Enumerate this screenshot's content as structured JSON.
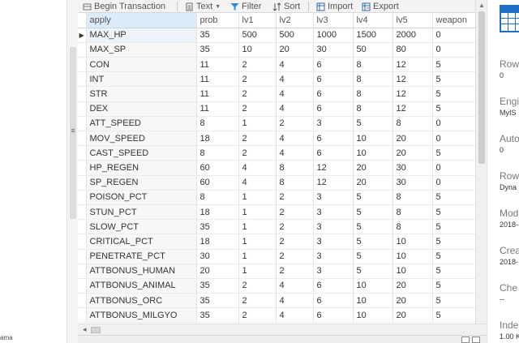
{
  "left_panel": {
    "tail_text": "ama"
  },
  "toolbar": {
    "begin_transaction": "Begin Transaction",
    "text": "Text",
    "filter": "Filter",
    "sort": "Sort",
    "import": "Import",
    "export": "Export"
  },
  "grid": {
    "columns": [
      "apply",
      "prob",
      "lv1",
      "lv2",
      "lv3",
      "lv4",
      "lv5",
      "weapon"
    ],
    "rows": [
      [
        "MAX_HP",
        "35",
        "500",
        "500",
        "1000",
        "1500",
        "2000",
        "0"
      ],
      [
        "MAX_SP",
        "35",
        "10",
        "20",
        "30",
        "50",
        "80",
        "0"
      ],
      [
        "CON",
        "11",
        "2",
        "4",
        "6",
        "8",
        "12",
        "5"
      ],
      [
        "INT",
        "11",
        "2",
        "4",
        "6",
        "8",
        "12",
        "5"
      ],
      [
        "STR",
        "11",
        "2",
        "4",
        "6",
        "8",
        "12",
        "5"
      ],
      [
        "DEX",
        "11",
        "2",
        "4",
        "6",
        "8",
        "12",
        "5"
      ],
      [
        "ATT_SPEED",
        "8",
        "1",
        "2",
        "3",
        "5",
        "8",
        "0"
      ],
      [
        "MOV_SPEED",
        "18",
        "2",
        "4",
        "6",
        "10",
        "20",
        "0"
      ],
      [
        "CAST_SPEED",
        "8",
        "2",
        "4",
        "6",
        "10",
        "20",
        "5"
      ],
      [
        "HP_REGEN",
        "60",
        "4",
        "8",
        "12",
        "20",
        "30",
        "0"
      ],
      [
        "SP_REGEN",
        "60",
        "4",
        "8",
        "12",
        "20",
        "30",
        "0"
      ],
      [
        "POISON_PCT",
        "8",
        "1",
        "2",
        "3",
        "5",
        "8",
        "5"
      ],
      [
        "STUN_PCT",
        "18",
        "1",
        "2",
        "3",
        "5",
        "8",
        "5"
      ],
      [
        "SLOW_PCT",
        "35",
        "1",
        "2",
        "3",
        "5",
        "8",
        "5"
      ],
      [
        "CRITICAL_PCT",
        "18",
        "1",
        "2",
        "3",
        "5",
        "10",
        "5"
      ],
      [
        "PENETRATE_PCT",
        "30",
        "1",
        "2",
        "3",
        "5",
        "10",
        "5"
      ],
      [
        "ATTBONUS_HUMAN",
        "20",
        "1",
        "2",
        "3",
        "5",
        "10",
        "5"
      ],
      [
        "ATTBONUS_ANIMAL",
        "35",
        "2",
        "4",
        "6",
        "10",
        "20",
        "5"
      ],
      [
        "ATTBONUS_ORC",
        "35",
        "2",
        "4",
        "6",
        "10",
        "20",
        "5"
      ],
      [
        "ATTBONUS_MILGYO",
        "35",
        "2",
        "4",
        "6",
        "10",
        "20",
        "5"
      ]
    ],
    "selected_row": 0,
    "row_indicator": "▶",
    "grip_glyph": "≡"
  },
  "properties": [
    {
      "label": "Row",
      "value": "0"
    },
    {
      "label": "Engi",
      "value": "MyIS"
    },
    {
      "label": "Auto",
      "value": "0"
    },
    {
      "label": "Row",
      "value": "Dyna"
    },
    {
      "label": "Mod",
      "value": "2018-"
    },
    {
      "label": "Crea",
      "value": "2018-"
    },
    {
      "label": "Che",
      "value": "--"
    },
    {
      "label": "Inde",
      "value": "1.00 K"
    }
  ],
  "colors": {
    "accent": "#1f6fc5",
    "header_highlight": "#dcebfa",
    "filter_icon": "#2e8ad8",
    "import_icon": "#2a64b0",
    "export_icon": "#2a64b0"
  }
}
